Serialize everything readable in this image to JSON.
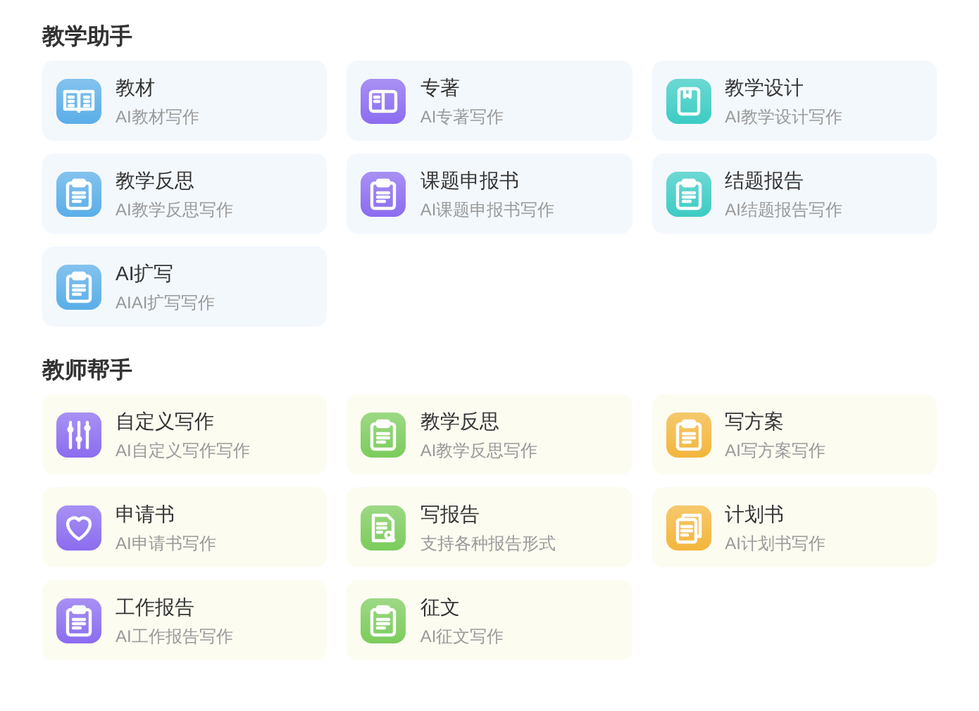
{
  "sections": [
    {
      "title": "教学助手",
      "items": [
        {
          "title": "教材",
          "subtitle": "AI教材写作",
          "kind": "book",
          "color": "#5aaee8"
        },
        {
          "title": "专著",
          "subtitle": "AI专著写作",
          "kind": "volume",
          "color": "#8b6cf0"
        },
        {
          "title": "教学设计",
          "subtitle": "AI教学设计写作",
          "kind": "bookmark",
          "color": "#3cccc4"
        },
        {
          "title": "教学反思",
          "subtitle": "AI教学反思写作",
          "kind": "clipboard",
          "color": "#5aaee8"
        },
        {
          "title": "课题申报书",
          "subtitle": "AI课题申报书写作",
          "kind": "clipboard",
          "color": "#8b6cf0"
        },
        {
          "title": "结题报告",
          "subtitle": "AI结题报告写作",
          "kind": "clipboard",
          "color": "#3cccc4"
        },
        {
          "title": "AI扩写",
          "subtitle": "AIAI扩写写作",
          "kind": "clipboard",
          "color": "#5aaee8"
        }
      ]
    },
    {
      "title": "教师帮手",
      "items": [
        {
          "title": "自定义写作",
          "subtitle": "AI自定义写作写作",
          "kind": "sliders",
          "color": "#8b6cf0"
        },
        {
          "title": "教学反思",
          "subtitle": "AI教学反思写作",
          "kind": "clipboard",
          "color": "#7ccc5c"
        },
        {
          "title": "写方案",
          "subtitle": "AI写方案写作",
          "kind": "clipboard",
          "color": "#f3b63c"
        },
        {
          "title": "申请书",
          "subtitle": "AI申请书写作",
          "kind": "heart",
          "color": "#8b6cf0"
        },
        {
          "title": "写报告",
          "subtitle": "支持各种报告形式",
          "kind": "search",
          "color": "#7ccc5c"
        },
        {
          "title": "计划书",
          "subtitle": "AI计划书写作",
          "kind": "docs",
          "color": "#f3b63c"
        },
        {
          "title": "工作报告",
          "subtitle": "AI工作报告写作",
          "kind": "clipboard",
          "color": "#8b6cf0"
        },
        {
          "title": "征文",
          "subtitle": "AI征文写作",
          "kind": "clipboard",
          "color": "#7ccc5c"
        }
      ]
    }
  ]
}
